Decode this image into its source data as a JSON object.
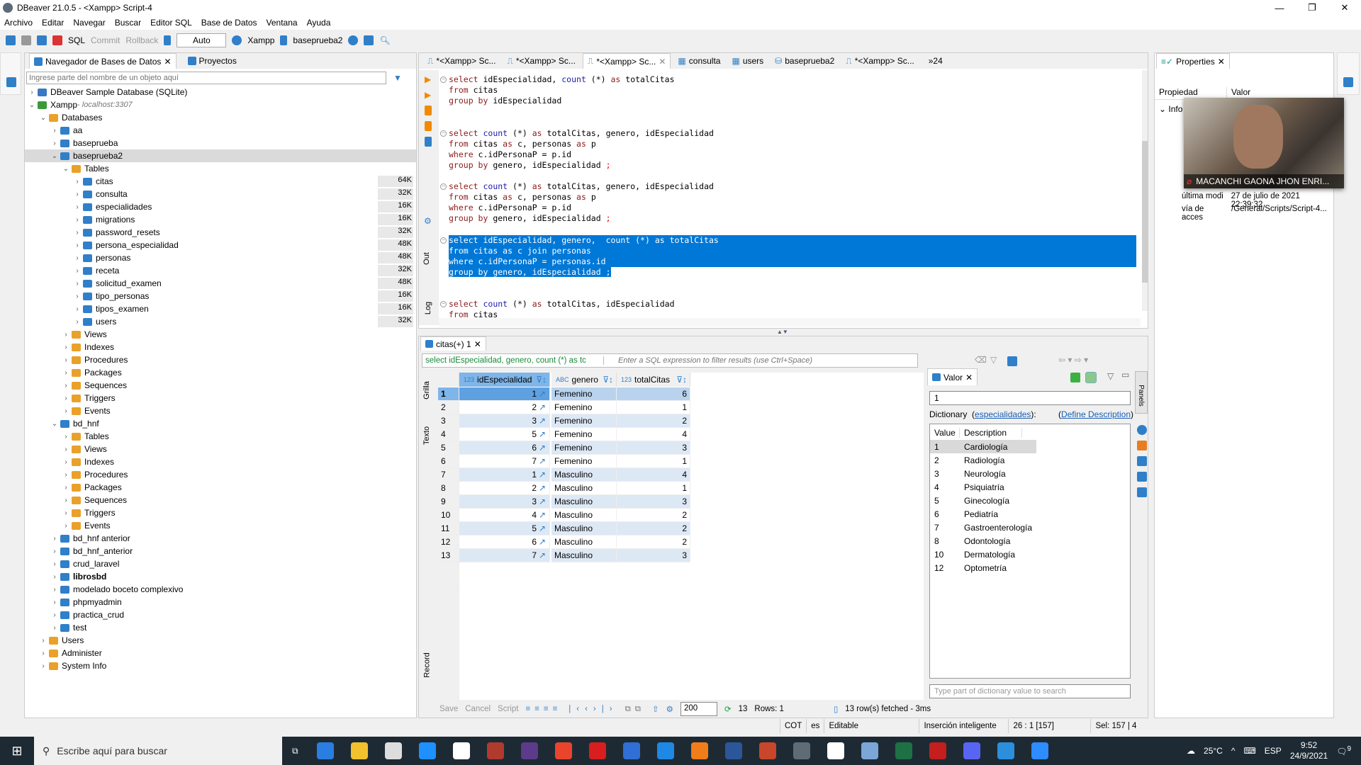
{
  "window": {
    "title": "DBeaver 21.0.5 - <Xampp> Script-4",
    "min": "—",
    "max": "❐",
    "close": "✕"
  },
  "menu": [
    "Archivo",
    "Editar",
    "Navegar",
    "Buscar",
    "Editor SQL",
    "Base de Datos",
    "Ventana",
    "Ayuda"
  ],
  "toolbar": {
    "sql": "SQL",
    "commit": "Commit",
    "rollback": "Rollback",
    "mode": "Auto",
    "connection": "Xampp",
    "database": "baseprueba2"
  },
  "navigator": {
    "tab1": "Navegador de Bases de Datos",
    "tab2": "Proyectos",
    "search_placeholder": "Ingrese parte del nombre de un objeto aquí",
    "items": [
      {
        "label": "DBeaver Sample Database (SQLite)",
        "level": 0,
        "exp": "›",
        "icon": "#3a78c2"
      },
      {
        "label": "Xampp",
        "sub": " - localhost:3307",
        "level": 0,
        "exp": "⌄",
        "icon": "#3a9a3a"
      },
      {
        "label": "Databases",
        "level": 1,
        "exp": "⌄",
        "icon": "#e9a12a"
      },
      {
        "label": "aa",
        "level": 2,
        "exp": "›",
        "icon": "#2f7fc9"
      },
      {
        "label": "baseprueba",
        "level": 2,
        "exp": "›",
        "icon": "#2f7fc9"
      },
      {
        "label": "baseprueba2",
        "level": 2,
        "exp": "⌄",
        "icon": "#2f7fc9",
        "sel": true
      },
      {
        "label": "Tables",
        "level": 3,
        "exp": "⌄",
        "icon": "#e9a12a"
      },
      {
        "label": "citas",
        "level": 4,
        "exp": "›",
        "icon": "#2f7fc9",
        "size": "64K"
      },
      {
        "label": "consulta",
        "level": 4,
        "exp": "›",
        "icon": "#2f7fc9",
        "size": "32K"
      },
      {
        "label": "especialidades",
        "level": 4,
        "exp": "›",
        "icon": "#2f7fc9",
        "size": "16K"
      },
      {
        "label": "migrations",
        "level": 4,
        "exp": "›",
        "icon": "#2f7fc9",
        "size": "16K"
      },
      {
        "label": "password_resets",
        "level": 4,
        "exp": "›",
        "icon": "#2f7fc9",
        "size": "32K"
      },
      {
        "label": "persona_especialidad",
        "level": 4,
        "exp": "›",
        "icon": "#2f7fc9",
        "size": "48K"
      },
      {
        "label": "personas",
        "level": 4,
        "exp": "›",
        "icon": "#2f7fc9",
        "size": "48K"
      },
      {
        "label": "receta",
        "level": 4,
        "exp": "›",
        "icon": "#2f7fc9",
        "size": "32K"
      },
      {
        "label": "solicitud_examen",
        "level": 4,
        "exp": "›",
        "icon": "#2f7fc9",
        "size": "48K"
      },
      {
        "label": "tipo_personas",
        "level": 4,
        "exp": "›",
        "icon": "#2f7fc9",
        "size": "16K"
      },
      {
        "label": "tipos_examen",
        "level": 4,
        "exp": "›",
        "icon": "#2f7fc9",
        "size": "16K"
      },
      {
        "label": "users",
        "level": 4,
        "exp": "›",
        "icon": "#2f7fc9",
        "size": "32K"
      },
      {
        "label": "Views",
        "level": 3,
        "exp": "›",
        "icon": "#e9a12a"
      },
      {
        "label": "Indexes",
        "level": 3,
        "exp": "›",
        "icon": "#e9a12a"
      },
      {
        "label": "Procedures",
        "level": 3,
        "exp": "›",
        "icon": "#e9a12a"
      },
      {
        "label": "Packages",
        "level": 3,
        "exp": "›",
        "icon": "#e9a12a"
      },
      {
        "label": "Sequences",
        "level": 3,
        "exp": "›",
        "icon": "#e9a12a"
      },
      {
        "label": "Triggers",
        "level": 3,
        "exp": "›",
        "icon": "#e9a12a"
      },
      {
        "label": "Events",
        "level": 3,
        "exp": "›",
        "icon": "#e9a12a"
      },
      {
        "label": "bd_hnf",
        "level": 2,
        "exp": "⌄",
        "icon": "#2f7fc9"
      },
      {
        "label": "Tables",
        "level": 3,
        "exp": "›",
        "icon": "#e9a12a"
      },
      {
        "label": "Views",
        "level": 3,
        "exp": "›",
        "icon": "#e9a12a"
      },
      {
        "label": "Indexes",
        "level": 3,
        "exp": "›",
        "icon": "#e9a12a"
      },
      {
        "label": "Procedures",
        "level": 3,
        "exp": "›",
        "icon": "#e9a12a"
      },
      {
        "label": "Packages",
        "level": 3,
        "exp": "›",
        "icon": "#e9a12a"
      },
      {
        "label": "Sequences",
        "level": 3,
        "exp": "›",
        "icon": "#e9a12a"
      },
      {
        "label": "Triggers",
        "level": 3,
        "exp": "›",
        "icon": "#e9a12a"
      },
      {
        "label": "Events",
        "level": 3,
        "exp": "›",
        "icon": "#e9a12a"
      },
      {
        "label": "bd_hnf anterior",
        "level": 2,
        "exp": "›",
        "icon": "#2f7fc9"
      },
      {
        "label": "bd_hnf_anterior",
        "level": 2,
        "exp": "›",
        "icon": "#2f7fc9"
      },
      {
        "label": "crud_laravel",
        "level": 2,
        "exp": "›",
        "icon": "#2f7fc9"
      },
      {
        "label": "librosbd",
        "level": 2,
        "exp": "›",
        "icon": "#2f7fc9",
        "bold": true
      },
      {
        "label": "modelado boceto complexivo",
        "level": 2,
        "exp": "›",
        "icon": "#2f7fc9"
      },
      {
        "label": "phpmyadmin",
        "level": 2,
        "exp": "›",
        "icon": "#2f7fc9"
      },
      {
        "label": "practica_crud",
        "level": 2,
        "exp": "›",
        "icon": "#2f7fc9"
      },
      {
        "label": "test",
        "level": 2,
        "exp": "›",
        "icon": "#2f7fc9"
      },
      {
        "label": "Users",
        "level": 1,
        "exp": "›",
        "icon": "#e9a12a"
      },
      {
        "label": "Administer",
        "level": 1,
        "exp": "›",
        "icon": "#e9a12a"
      },
      {
        "label": "System Info",
        "level": 1,
        "exp": "›",
        "icon": "#e9a12a"
      }
    ]
  },
  "editor_tabs": [
    "*<Xampp> Sc...",
    "*<Xampp> Sc...",
    "*<Xampp> Sc...",
    "consulta",
    "users",
    "baseprueba2",
    "*<Xampp> Sc..."
  ],
  "editor_tabs_more": "»24",
  "side_labels": {
    "out": "Out",
    "log": "Log",
    "grid": "Grilla",
    "text": "Texto",
    "record": "Record",
    "panels": "Panels"
  },
  "code": [
    {
      "line": 0,
      "fold": true,
      "tokens": [
        [
          "select",
          "kw"
        ],
        " idEspecialidad, ",
        [
          "count",
          "fn"
        ],
        " (*) ",
        [
          "as",
          "kw"
        ],
        " totalCitas"
      ]
    },
    {
      "line": 1,
      "tokens": [
        [
          "from",
          "kw"
        ],
        " citas"
      ]
    },
    {
      "line": 2,
      "tokens": [
        [
          "group by",
          "kw"
        ],
        " idEspecialidad"
      ]
    },
    {
      "line": 5,
      "fold": true,
      "tokens": [
        [
          "select",
          "kw"
        ],
        " ",
        [
          "count",
          "fn"
        ],
        " (*) ",
        [
          "as",
          "kw"
        ],
        " totalCitas, genero, idEspecialidad"
      ]
    },
    {
      "line": 6,
      "tokens": [
        [
          "from",
          "kw"
        ],
        " citas ",
        [
          "as",
          "kw"
        ],
        " c, personas ",
        [
          "as",
          "kw"
        ],
        " p"
      ]
    },
    {
      "line": 7,
      "tokens": [
        [
          "where",
          "kw"
        ],
        " c.idPersonaP = p.id"
      ]
    },
    {
      "line": 8,
      "tokens": [
        [
          "group by",
          "kw"
        ],
        " genero, idEspecialidad ",
        [
          ";",
          "sc"
        ]
      ]
    },
    {
      "line": 10,
      "fold": true,
      "tokens": [
        [
          "select",
          "kw"
        ],
        " ",
        [
          "count",
          "fn"
        ],
        " (*) ",
        [
          "as",
          "kw"
        ],
        " totalCitas, genero, idEspecialidad"
      ]
    },
    {
      "line": 11,
      "tokens": [
        [
          "from",
          "kw"
        ],
        " citas ",
        [
          "as",
          "kw"
        ],
        " c, personas ",
        [
          "as",
          "kw"
        ],
        " p"
      ]
    },
    {
      "line": 12,
      "tokens": [
        [
          "where",
          "kw"
        ],
        " c.idPersonaP = p.id"
      ]
    },
    {
      "line": 13,
      "tokens": [
        [
          "group by",
          "kw"
        ],
        " genero, idEspecialidad ",
        [
          ";",
          "sc"
        ]
      ]
    },
    {
      "line": 15,
      "fold": true,
      "hl": true,
      "tokens": [
        [
          "select",
          "kw"
        ],
        " idEspecialidad, genero,  ",
        [
          "count",
          "fn"
        ],
        " (*) ",
        [
          "as",
          "kw"
        ],
        " totalCitas"
      ]
    },
    {
      "line": 16,
      "hl": true,
      "tokens": [
        [
          "from",
          "kw"
        ],
        " citas ",
        [
          "as",
          "kw"
        ],
        " c ",
        [
          "join",
          "kw"
        ],
        " personas"
      ]
    },
    {
      "line": 17,
      "hl": true,
      "tokens": [
        [
          "where",
          "kw"
        ],
        " c.idPersonaP = personas.id"
      ]
    },
    {
      "line": 18,
      "hlpart": true,
      "tokens": [
        [
          "group by",
          "kw"
        ],
        " genero, idEspecialidad ",
        [
          ";",
          "sc"
        ]
      ]
    },
    {
      "line": 21,
      "fold": true,
      "tokens": [
        [
          "select",
          "kw"
        ],
        " ",
        [
          "count",
          "fn"
        ],
        " (*) ",
        [
          "as",
          "kw"
        ],
        " totalCitas, idEspecialidad"
      ]
    },
    {
      "line": 22,
      "tokens": [
        [
          "from",
          "kw"
        ],
        " citas"
      ]
    }
  ],
  "results": {
    "tab": "citas(+) 1",
    "query": "select idEspecialidad, genero, count (*) as tc",
    "filter_placeholder": "Enter a SQL expression to filter results (use Ctrl+Space)",
    "columns": [
      {
        "name": "idEspecialidad",
        "type": "123"
      },
      {
        "name": "genero",
        "type": "ABC"
      },
      {
        "name": "totalCitas",
        "type": "123"
      }
    ],
    "rows": [
      [
        1,
        "Femenino",
        6
      ],
      [
        2,
        "Femenino",
        1
      ],
      [
        3,
        "Femenino",
        2
      ],
      [
        5,
        "Femenino",
        4
      ],
      [
        6,
        "Femenino",
        3
      ],
      [
        7,
        "Femenino",
        1
      ],
      [
        1,
        "Masculino",
        4
      ],
      [
        2,
        "Masculino",
        1
      ],
      [
        3,
        "Masculino",
        3
      ],
      [
        4,
        "Masculino",
        2
      ],
      [
        5,
        "Masculino",
        2
      ],
      [
        6,
        "Masculino",
        2
      ],
      [
        7,
        "Masculino",
        3
      ]
    ]
  },
  "valor": {
    "title": "Valor",
    "value": "1",
    "dict_label": "Dictionary",
    "dict_table": "especialidades",
    "define": "Define Description",
    "col_value": "Value",
    "col_desc": "Description",
    "search_placeholder": "Type part of dictionary value to search",
    "entries": [
      [
        "1",
        "Cardiología"
      ],
      [
        "2",
        "Radiología"
      ],
      [
        "3",
        "Neurología"
      ],
      [
        "4",
        "Psiquiatría"
      ],
      [
        "5",
        "Ginecología"
      ],
      [
        "6",
        "Pediatría"
      ],
      [
        "7",
        "Gastroenterología"
      ],
      [
        "8",
        "Odontología"
      ],
      [
        "10",
        "Dermatología"
      ],
      [
        "12",
        "Optometría"
      ]
    ]
  },
  "bottom_toolbar": {
    "save": "Save",
    "cancel": "Cancel",
    "script": "Script",
    "fetch_size": "200",
    "count": "13",
    "rows": "Rows: 1",
    "fetched": "13 row(s) fetched - 3ms"
  },
  "status": {
    "tz": "COT",
    "lang": "es",
    "mode": "Editable",
    "insert": "Inserción inteligente",
    "pos": "26 : 1 [157]",
    "sel": "Sel: 157 | 4"
  },
  "properties": {
    "title": "Properties",
    "col_prop": "Propiedad",
    "col_val": "Valor",
    "group": "Info",
    "rows": [
      [
        "última modi",
        "27 de julio de 2021 22:39:32"
      ],
      [
        "vía de acces",
        "/General/Scripts/Script-4..."
      ]
    ]
  },
  "video": {
    "name": "MACANCHI GAONA JHON ENRI..."
  },
  "taskbar": {
    "search": "Escribe aquí para buscar",
    "weather": "25°C",
    "lang": "ESP",
    "time": "9:52",
    "date": "24/9/2021",
    "notif": "9",
    "apps": [
      "#2a7de1",
      "#f2c12e",
      "#ddd",
      "#1e90ff",
      "#fff",
      "#b03a2e",
      "#5c3b8a",
      "#e8452c",
      "#d81e1e",
      "#2f6fd6",
      "#1e88e5",
      "#f07d1a",
      "#2b579a",
      "#c8462c",
      "#5f6b75",
      "#fff",
      "#7aa7d8",
      "#1e7145",
      "#c41e1e",
      "#5865f2",
      "#2b8fdc",
      "#2d8cff"
    ]
  },
  "colors": {
    "selection": "#0078d7",
    "accent": "#2f7fc9"
  }
}
